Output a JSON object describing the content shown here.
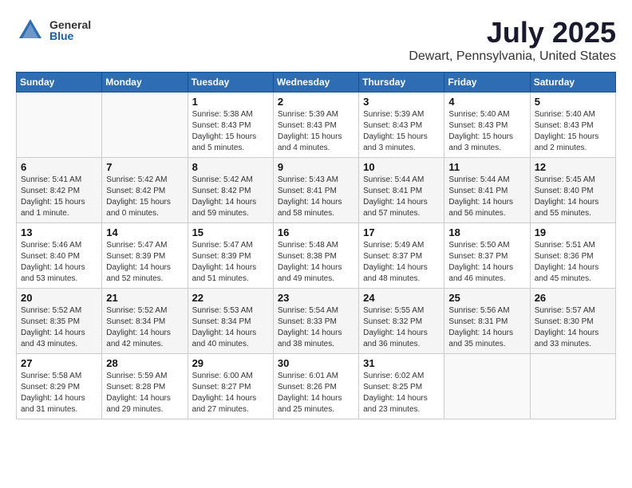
{
  "header": {
    "logo_general": "General",
    "logo_blue": "Blue",
    "title": "July 2025",
    "location": "Dewart, Pennsylvania, United States"
  },
  "weekdays": [
    "Sunday",
    "Monday",
    "Tuesday",
    "Wednesday",
    "Thursday",
    "Friday",
    "Saturday"
  ],
  "weeks": [
    [
      {
        "day": "",
        "info": ""
      },
      {
        "day": "",
        "info": ""
      },
      {
        "day": "1",
        "info": "Sunrise: 5:38 AM\nSunset: 8:43 PM\nDaylight: 15 hours\nand 5 minutes."
      },
      {
        "day": "2",
        "info": "Sunrise: 5:39 AM\nSunset: 8:43 PM\nDaylight: 15 hours\nand 4 minutes."
      },
      {
        "day": "3",
        "info": "Sunrise: 5:39 AM\nSunset: 8:43 PM\nDaylight: 15 hours\nand 3 minutes."
      },
      {
        "day": "4",
        "info": "Sunrise: 5:40 AM\nSunset: 8:43 PM\nDaylight: 15 hours\nand 3 minutes."
      },
      {
        "day": "5",
        "info": "Sunrise: 5:40 AM\nSunset: 8:43 PM\nDaylight: 15 hours\nand 2 minutes."
      }
    ],
    [
      {
        "day": "6",
        "info": "Sunrise: 5:41 AM\nSunset: 8:42 PM\nDaylight: 15 hours\nand 1 minute."
      },
      {
        "day": "7",
        "info": "Sunrise: 5:42 AM\nSunset: 8:42 PM\nDaylight: 15 hours\nand 0 minutes."
      },
      {
        "day": "8",
        "info": "Sunrise: 5:42 AM\nSunset: 8:42 PM\nDaylight: 14 hours\nand 59 minutes."
      },
      {
        "day": "9",
        "info": "Sunrise: 5:43 AM\nSunset: 8:41 PM\nDaylight: 14 hours\nand 58 minutes."
      },
      {
        "day": "10",
        "info": "Sunrise: 5:44 AM\nSunset: 8:41 PM\nDaylight: 14 hours\nand 57 minutes."
      },
      {
        "day": "11",
        "info": "Sunrise: 5:44 AM\nSunset: 8:41 PM\nDaylight: 14 hours\nand 56 minutes."
      },
      {
        "day": "12",
        "info": "Sunrise: 5:45 AM\nSunset: 8:40 PM\nDaylight: 14 hours\nand 55 minutes."
      }
    ],
    [
      {
        "day": "13",
        "info": "Sunrise: 5:46 AM\nSunset: 8:40 PM\nDaylight: 14 hours\nand 53 minutes."
      },
      {
        "day": "14",
        "info": "Sunrise: 5:47 AM\nSunset: 8:39 PM\nDaylight: 14 hours\nand 52 minutes."
      },
      {
        "day": "15",
        "info": "Sunrise: 5:47 AM\nSunset: 8:39 PM\nDaylight: 14 hours\nand 51 minutes."
      },
      {
        "day": "16",
        "info": "Sunrise: 5:48 AM\nSunset: 8:38 PM\nDaylight: 14 hours\nand 49 minutes."
      },
      {
        "day": "17",
        "info": "Sunrise: 5:49 AM\nSunset: 8:37 PM\nDaylight: 14 hours\nand 48 minutes."
      },
      {
        "day": "18",
        "info": "Sunrise: 5:50 AM\nSunset: 8:37 PM\nDaylight: 14 hours\nand 46 minutes."
      },
      {
        "day": "19",
        "info": "Sunrise: 5:51 AM\nSunset: 8:36 PM\nDaylight: 14 hours\nand 45 minutes."
      }
    ],
    [
      {
        "day": "20",
        "info": "Sunrise: 5:52 AM\nSunset: 8:35 PM\nDaylight: 14 hours\nand 43 minutes."
      },
      {
        "day": "21",
        "info": "Sunrise: 5:52 AM\nSunset: 8:34 PM\nDaylight: 14 hours\nand 42 minutes."
      },
      {
        "day": "22",
        "info": "Sunrise: 5:53 AM\nSunset: 8:34 PM\nDaylight: 14 hours\nand 40 minutes."
      },
      {
        "day": "23",
        "info": "Sunrise: 5:54 AM\nSunset: 8:33 PM\nDaylight: 14 hours\nand 38 minutes."
      },
      {
        "day": "24",
        "info": "Sunrise: 5:55 AM\nSunset: 8:32 PM\nDaylight: 14 hours\nand 36 minutes."
      },
      {
        "day": "25",
        "info": "Sunrise: 5:56 AM\nSunset: 8:31 PM\nDaylight: 14 hours\nand 35 minutes."
      },
      {
        "day": "26",
        "info": "Sunrise: 5:57 AM\nSunset: 8:30 PM\nDaylight: 14 hours\nand 33 minutes."
      }
    ],
    [
      {
        "day": "27",
        "info": "Sunrise: 5:58 AM\nSunset: 8:29 PM\nDaylight: 14 hours\nand 31 minutes."
      },
      {
        "day": "28",
        "info": "Sunrise: 5:59 AM\nSunset: 8:28 PM\nDaylight: 14 hours\nand 29 minutes."
      },
      {
        "day": "29",
        "info": "Sunrise: 6:00 AM\nSunset: 8:27 PM\nDaylight: 14 hours\nand 27 minutes."
      },
      {
        "day": "30",
        "info": "Sunrise: 6:01 AM\nSunset: 8:26 PM\nDaylight: 14 hours\nand 25 minutes."
      },
      {
        "day": "31",
        "info": "Sunrise: 6:02 AM\nSunset: 8:25 PM\nDaylight: 14 hours\nand 23 minutes."
      },
      {
        "day": "",
        "info": ""
      },
      {
        "day": "",
        "info": ""
      }
    ]
  ]
}
